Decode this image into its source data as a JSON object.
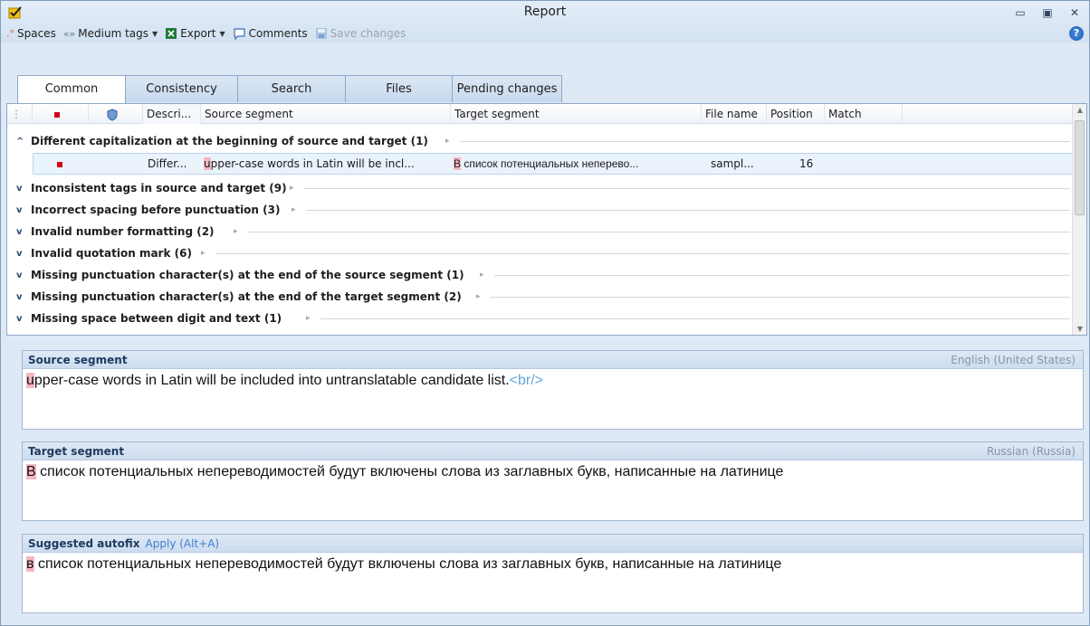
{
  "window": {
    "title": "Report"
  },
  "toolbar": {
    "spaces": "Spaces",
    "medium_tags": "Medium tags",
    "export": "Export",
    "comments": "Comments",
    "save_changes": "Save changes"
  },
  "tabs": [
    {
      "label": "Common"
    },
    {
      "label": "Consistency"
    },
    {
      "label": "Search"
    },
    {
      "label": "Files"
    },
    {
      "label": "Pending changes"
    }
  ],
  "grid": {
    "headers": {
      "description": "Descri...",
      "source": "Source segment",
      "target": "Target segment",
      "file": "File name",
      "position": "Position",
      "match": "Match"
    },
    "groups": [
      {
        "label": "Different capitalization at the beginning of source and target (1)",
        "expanded": true
      },
      {
        "label": "Inconsistent tags in source and target (9)",
        "expanded": false
      },
      {
        "label": "Incorrect spacing before punctuation (3)",
        "expanded": false
      },
      {
        "label": "Invalid number formatting (2)",
        "expanded": false
      },
      {
        "label": "Invalid quotation mark (6)",
        "expanded": false
      },
      {
        "label": "Missing punctuation character(s) at the end of the source segment (1)",
        "expanded": false
      },
      {
        "label": "Missing punctuation character(s) at the end of the target segment (2)",
        "expanded": false
      },
      {
        "label": "Missing space between digit and text (1)",
        "expanded": false
      }
    ],
    "detail": {
      "description": "Differ...",
      "source_first": "u",
      "source_rest": "pper-case words in Latin will be incl...",
      "target_first": "В",
      "target_rest": " список потенциальных неперево...",
      "file": "sampl...",
      "position": "16"
    }
  },
  "source_panel": {
    "title": "Source segment",
    "language": "English (United States)",
    "first_char": "u",
    "text": "pper-case words in Latin will be included into untranslatable candidate list.",
    "tag": "<br/>"
  },
  "target_panel": {
    "title": "Target segment",
    "language": "Russian (Russia)",
    "first_char": "В",
    "text": " список потенциальных непереводимостей будут включены слова из заглавных букв, написанные на латинице"
  },
  "autofix_panel": {
    "title": "Suggested autofix",
    "apply": "Apply (Alt+A)",
    "first_char": "в",
    "text": " список потенциальных непереводимостей будут включены слова из заглавных букв, написанные на латинице"
  },
  "colors": {
    "highlight": "#f4b7c2",
    "tag": "#5fa8d8",
    "error_marker": "#d4001a"
  }
}
